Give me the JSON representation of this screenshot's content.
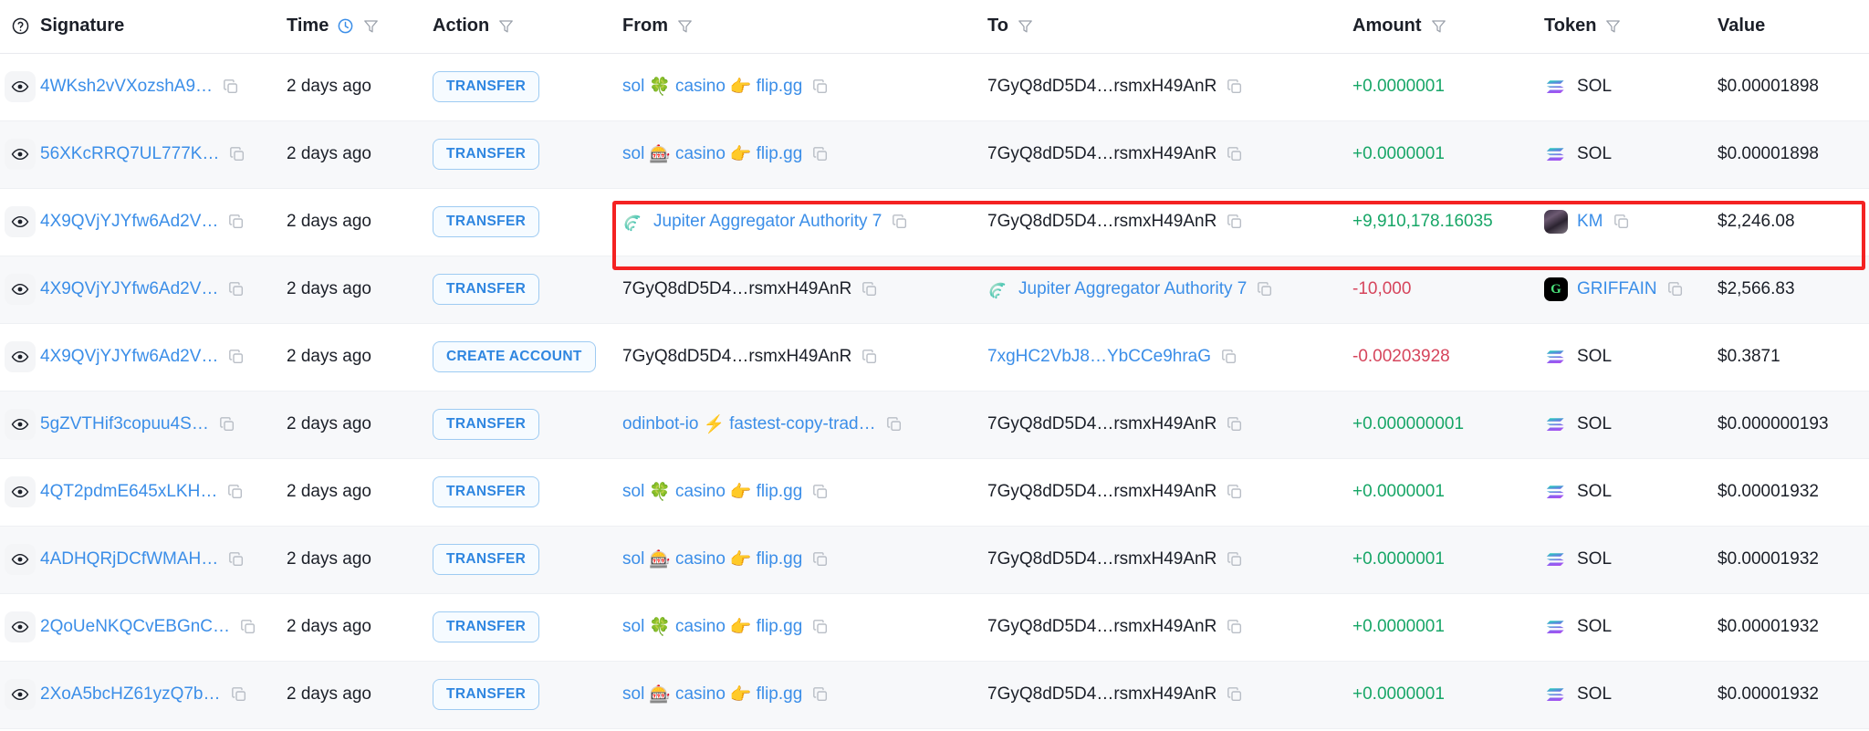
{
  "table": {
    "columns": [
      {
        "key": "eye",
        "label": "",
        "icon": "help-circle-icon",
        "filter": false,
        "clock": false
      },
      {
        "key": "signature",
        "label": "Signature",
        "icon": "",
        "filter": false,
        "clock": false
      },
      {
        "key": "time",
        "label": "Time",
        "icon": "",
        "filter": true,
        "clock": true
      },
      {
        "key": "action",
        "label": "Action",
        "icon": "",
        "filter": true,
        "clock": false
      },
      {
        "key": "from",
        "label": "From",
        "icon": "",
        "filter": true,
        "clock": false
      },
      {
        "key": "to",
        "label": "To",
        "icon": "",
        "filter": true,
        "clock": false
      },
      {
        "key": "amount",
        "label": "Amount",
        "icon": "",
        "filter": true,
        "clock": false
      },
      {
        "key": "token",
        "label": "Token",
        "icon": "",
        "filter": true,
        "clock": false
      },
      {
        "key": "value",
        "label": "Value",
        "icon": "",
        "filter": false,
        "clock": false
      }
    ],
    "rows": [
      {
        "signature": "4WKsh2vVXozshA9…",
        "time": "2 days ago",
        "action": "TRANSFER",
        "from": {
          "emoji_prefix": "sol",
          "emoji": "🍀",
          "emoji_name": "four-leaf-clover-emoji",
          "mid": "casino",
          "emoji2": "👉",
          "emoji2_name": "pointing-right-emoji",
          "suffix": "flip.gg",
          "style": "label",
          "copy": true
        },
        "to": {
          "text": "7GyQ8dD5D4…rsmxH49AnR",
          "style": "plain",
          "copy": true
        },
        "amount": "+0.0000001",
        "amount_sign": "positive",
        "token": {
          "name": "SOL",
          "icon": "solana-icon",
          "link": false,
          "copy": false
        },
        "value": "$0.00001898",
        "highlighted": false
      },
      {
        "signature": "56XKcRRQ7UL777K…",
        "time": "2 days ago",
        "action": "TRANSFER",
        "from": {
          "emoji_prefix": "sol",
          "emoji": "🎰",
          "emoji_name": "slot-machine-emoji",
          "mid": "casino",
          "emoji2": "👉",
          "emoji2_name": "pointing-right-emoji",
          "suffix": "flip.gg",
          "style": "label",
          "copy": true
        },
        "to": {
          "text": "7GyQ8dD5D4…rsmxH49AnR",
          "style": "plain",
          "copy": true
        },
        "amount": "+0.0000001",
        "amount_sign": "positive",
        "token": {
          "name": "SOL",
          "icon": "solana-icon",
          "link": false,
          "copy": false
        },
        "value": "$0.00001898",
        "highlighted": false
      },
      {
        "signature": "4X9QVjYJYfw6Ad2V…",
        "time": "2 days ago",
        "action": "TRANSFER",
        "from": {
          "text": "Jupiter Aggregator Authority 7",
          "style": "link",
          "icon": "jupiter-icon",
          "copy": true
        },
        "to": {
          "text": "7GyQ8dD5D4…rsmxH49AnR",
          "style": "plain",
          "copy": true
        },
        "amount": "+9,910,178.16035",
        "amount_sign": "positive",
        "token": {
          "name": "KM",
          "icon": "km-token-icon",
          "link": true,
          "copy": true
        },
        "value": "$2,246.08",
        "highlighted": true
      },
      {
        "signature": "4X9QVjYJYfw6Ad2V…",
        "time": "2 days ago",
        "action": "TRANSFER",
        "from": {
          "text": "7GyQ8dD5D4…rsmxH49AnR",
          "style": "plain",
          "copy": true
        },
        "to": {
          "text": "Jupiter Aggregator Authority 7",
          "style": "link",
          "icon": "jupiter-icon",
          "copy": true
        },
        "amount": "-10,000",
        "amount_sign": "negative",
        "token": {
          "name": "GRIFFAIN",
          "icon": "griffain-token-icon",
          "link": true,
          "copy": true
        },
        "value": "$2,566.83",
        "highlighted": false
      },
      {
        "signature": "4X9QVjYJYfw6Ad2V…",
        "time": "2 days ago",
        "action": "CREATE ACCOUNT",
        "from": {
          "text": "7GyQ8dD5D4…rsmxH49AnR",
          "style": "plain",
          "copy": true
        },
        "to": {
          "text": "7xgHC2VbJ8…YbCCe9hraG",
          "style": "link",
          "copy": true
        },
        "amount": "-0.00203928",
        "amount_sign": "negative",
        "token": {
          "name": "SOL",
          "icon": "solana-icon",
          "link": false,
          "copy": false
        },
        "value": "$0.3871",
        "highlighted": false
      },
      {
        "signature": "5gZVTHif3copuu4S…",
        "time": "2 days ago",
        "action": "TRANSFER",
        "from": {
          "emoji_prefix": "odinbot-io",
          "emoji": "⚡",
          "emoji_name": "high-voltage-emoji",
          "mid": "fastest-copy-trad…",
          "emoji2": "",
          "emoji2_name": "",
          "suffix": "",
          "style": "label",
          "copy": true
        },
        "to": {
          "text": "7GyQ8dD5D4…rsmxH49AnR",
          "style": "plain",
          "copy": true
        },
        "amount": "+0.000000001",
        "amount_sign": "positive",
        "token": {
          "name": "SOL",
          "icon": "solana-icon",
          "link": false,
          "copy": false
        },
        "value": "$0.000000193",
        "highlighted": false
      },
      {
        "signature": "4QT2pdmE645xLKH…",
        "time": "2 days ago",
        "action": "TRANSFER",
        "from": {
          "emoji_prefix": "sol",
          "emoji": "🍀",
          "emoji_name": "four-leaf-clover-emoji",
          "mid": "casino",
          "emoji2": "👉",
          "emoji2_name": "pointing-right-emoji",
          "suffix": "flip.gg",
          "style": "label",
          "copy": true
        },
        "to": {
          "text": "7GyQ8dD5D4…rsmxH49AnR",
          "style": "plain",
          "copy": true
        },
        "amount": "+0.0000001",
        "amount_sign": "positive",
        "token": {
          "name": "SOL",
          "icon": "solana-icon",
          "link": false,
          "copy": false
        },
        "value": "$0.00001932",
        "highlighted": false
      },
      {
        "signature": "4ADHQRjDCfWMAH…",
        "time": "2 days ago",
        "action": "TRANSFER",
        "from": {
          "emoji_prefix": "sol",
          "emoji": "🎰",
          "emoji_name": "slot-machine-emoji",
          "mid": "casino",
          "emoji2": "👉",
          "emoji2_name": "pointing-right-emoji",
          "suffix": "flip.gg",
          "style": "label",
          "copy": true
        },
        "to": {
          "text": "7GyQ8dD5D4…rsmxH49AnR",
          "style": "plain",
          "copy": true
        },
        "amount": "+0.0000001",
        "amount_sign": "positive",
        "token": {
          "name": "SOL",
          "icon": "solana-icon",
          "link": false,
          "copy": false
        },
        "value": "$0.00001932",
        "highlighted": false
      },
      {
        "signature": "2QoUeNKQCvEBGnC…",
        "time": "2 days ago",
        "action": "TRANSFER",
        "from": {
          "emoji_prefix": "sol",
          "emoji": "🍀",
          "emoji_name": "four-leaf-clover-emoji",
          "mid": "casino",
          "emoji2": "👉",
          "emoji2_name": "pointing-right-emoji",
          "suffix": "flip.gg",
          "style": "label",
          "copy": true
        },
        "to": {
          "text": "7GyQ8dD5D4…rsmxH49AnR",
          "style": "plain",
          "copy": true
        },
        "amount": "+0.0000001",
        "amount_sign": "positive",
        "token": {
          "name": "SOL",
          "icon": "solana-icon",
          "link": false,
          "copy": false
        },
        "value": "$0.00001932",
        "highlighted": false
      },
      {
        "signature": "2XoA5bcHZ61yzQ7b…",
        "time": "2 days ago",
        "action": "TRANSFER",
        "from": {
          "emoji_prefix": "sol",
          "emoji": "🎰",
          "emoji_name": "slot-machine-emoji",
          "mid": "casino",
          "emoji2": "👉",
          "emoji2_name": "pointing-right-emoji",
          "suffix": "flip.gg",
          "style": "label",
          "copy": true
        },
        "to": {
          "text": "7GyQ8dD5D4…rsmxH49AnR",
          "style": "plain",
          "copy": true
        },
        "amount": "+0.0000001",
        "amount_sign": "positive",
        "token": {
          "name": "SOL",
          "icon": "solana-icon",
          "link": false,
          "copy": false
        },
        "value": "$0.00001932",
        "highlighted": false
      }
    ]
  },
  "colors": {
    "link": "#3b8ee8",
    "positive": "#17a667",
    "negative": "#d6455c",
    "pill_border": "#9ecbf2",
    "pill_text": "#2f86e0",
    "highlight": "#f42222"
  }
}
